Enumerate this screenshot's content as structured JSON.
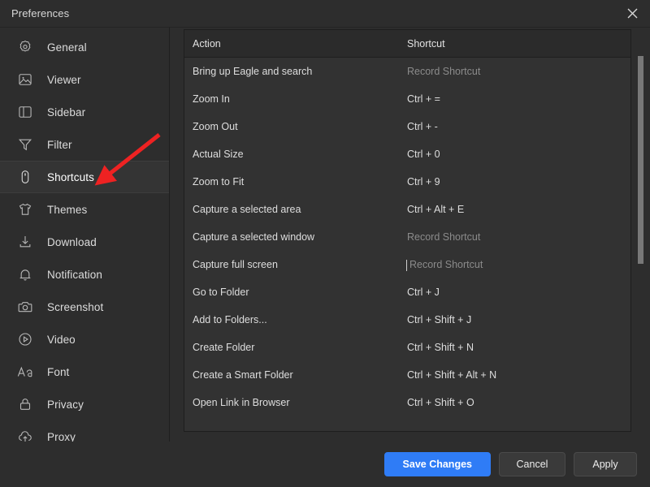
{
  "window": {
    "title": "Preferences",
    "close_icon": "close-icon"
  },
  "sidebar": {
    "items": [
      {
        "label": "General",
        "icon": "gear-icon",
        "active": false
      },
      {
        "label": "Viewer",
        "icon": "image-icon",
        "active": false
      },
      {
        "label": "Sidebar",
        "icon": "sidebar-icon",
        "active": false
      },
      {
        "label": "Filter",
        "icon": "funnel-icon",
        "active": false
      },
      {
        "label": "Shortcuts",
        "icon": "mouse-icon",
        "active": true
      },
      {
        "label": "Themes",
        "icon": "tshirt-icon",
        "active": false
      },
      {
        "label": "Download",
        "icon": "download-icon",
        "active": false
      },
      {
        "label": "Notification",
        "icon": "bell-icon",
        "active": false
      },
      {
        "label": "Screenshot",
        "icon": "camera-icon",
        "active": false
      },
      {
        "label": "Video",
        "icon": "play-circle-icon",
        "active": false
      },
      {
        "label": "Font",
        "icon": "font-aa-icon",
        "active": false
      },
      {
        "label": "Privacy",
        "icon": "lock-icon",
        "active": false
      },
      {
        "label": "Proxy",
        "icon": "cloud-upload-icon",
        "active": false
      }
    ]
  },
  "shortcuts_table": {
    "columns": [
      "Action",
      "Shortcut"
    ],
    "placeholder_text": "Record Shortcut",
    "rows": [
      {
        "action": "Bring up Eagle and search",
        "shortcut": "Record Shortcut",
        "unset": true,
        "focused": false
      },
      {
        "action": "Zoom In",
        "shortcut": "Ctrl + =",
        "unset": false,
        "focused": false
      },
      {
        "action": "Zoom Out",
        "shortcut": "Ctrl + -",
        "unset": false,
        "focused": false
      },
      {
        "action": "Actual Size",
        "shortcut": "Ctrl + 0",
        "unset": false,
        "focused": false
      },
      {
        "action": "Zoom to Fit",
        "shortcut": "Ctrl + 9",
        "unset": false,
        "focused": false
      },
      {
        "action": "Capture a selected area",
        "shortcut": "Ctrl + Alt + E",
        "unset": false,
        "focused": false
      },
      {
        "action": "Capture a selected window",
        "shortcut": "Record Shortcut",
        "unset": true,
        "focused": false
      },
      {
        "action": "Capture full screen",
        "shortcut": "Record Shortcut",
        "unset": true,
        "focused": true
      },
      {
        "action": "Go to Folder",
        "shortcut": "Ctrl + J",
        "unset": false,
        "focused": false
      },
      {
        "action": "Add to Folders...",
        "shortcut": "Ctrl + Shift + J",
        "unset": false,
        "focused": false
      },
      {
        "action": "Create Folder",
        "shortcut": "Ctrl + Shift + N",
        "unset": false,
        "focused": false
      },
      {
        "action": "Create a Smart Folder",
        "shortcut": "Ctrl + Shift + Alt + N",
        "unset": false,
        "focused": false
      },
      {
        "action": "Open Link in Browser",
        "shortcut": "Ctrl + Shift + O",
        "unset": false,
        "focused": false
      }
    ]
  },
  "footer": {
    "save_label": "Save Changes",
    "cancel_label": "Cancel",
    "apply_label": "Apply"
  },
  "annotation": {
    "arrow_color": "#ee2222",
    "points_to": "Shortcuts"
  }
}
